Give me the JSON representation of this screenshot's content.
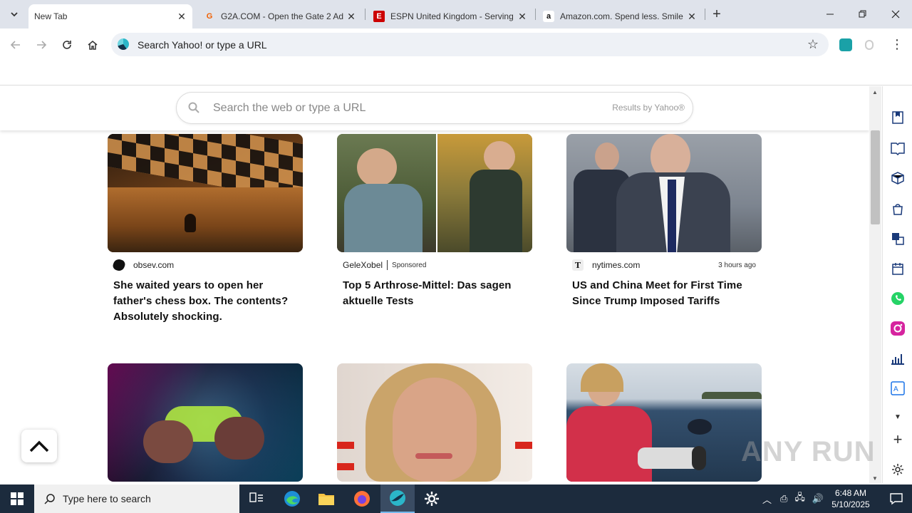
{
  "tabs": [
    {
      "title": "New Tab",
      "favicon": "none",
      "active": true
    },
    {
      "title": "G2A.COM - Open the Gate 2 Ad",
      "favicon": "G",
      "favicon_color": "#f05f00"
    },
    {
      "title": "ESPN United Kingdom - Serving",
      "favicon": "E",
      "favicon_color": "#cc0000"
    },
    {
      "title": "Amazon.com. Spend less. Smile",
      "favicon": "a",
      "favicon_color": "#111111"
    }
  ],
  "omnibox": {
    "text": "Search Yahoo! or type a URL"
  },
  "search": {
    "placeholder": "Search the web or type a URL",
    "results_by": "Results by Yahoo®"
  },
  "cards": [
    {
      "source": "obsev.com",
      "headline": "She waited years to open her father's chess box. The contents? Absolutely shocking.",
      "image": "chess box"
    },
    {
      "source": "GeleXobel",
      "sponsored": "Sponsored",
      "headline": "Top 5 Arthrose-Mittel: Das sagen aktuelle Tests",
      "image": "older man"
    },
    {
      "source": "nytimes.com",
      "time": "3 hours ago",
      "headline": "US and China Meet for First Time Since Trump Imposed Tariffs",
      "image": "man in suit"
    },
    {
      "image": "game controller"
    },
    {
      "image": "woman portrait"
    },
    {
      "image": "sailor with camera"
    }
  ],
  "taskbar": {
    "search_placeholder": "Type here to search",
    "time": "6:48 AM",
    "date": "5/10/2025"
  },
  "watermark": "ANY RUN",
  "colors": {
    "tabbar": "#dfe3eb",
    "taskbar": "#1c2b3d",
    "accent": "#1a73e8"
  }
}
